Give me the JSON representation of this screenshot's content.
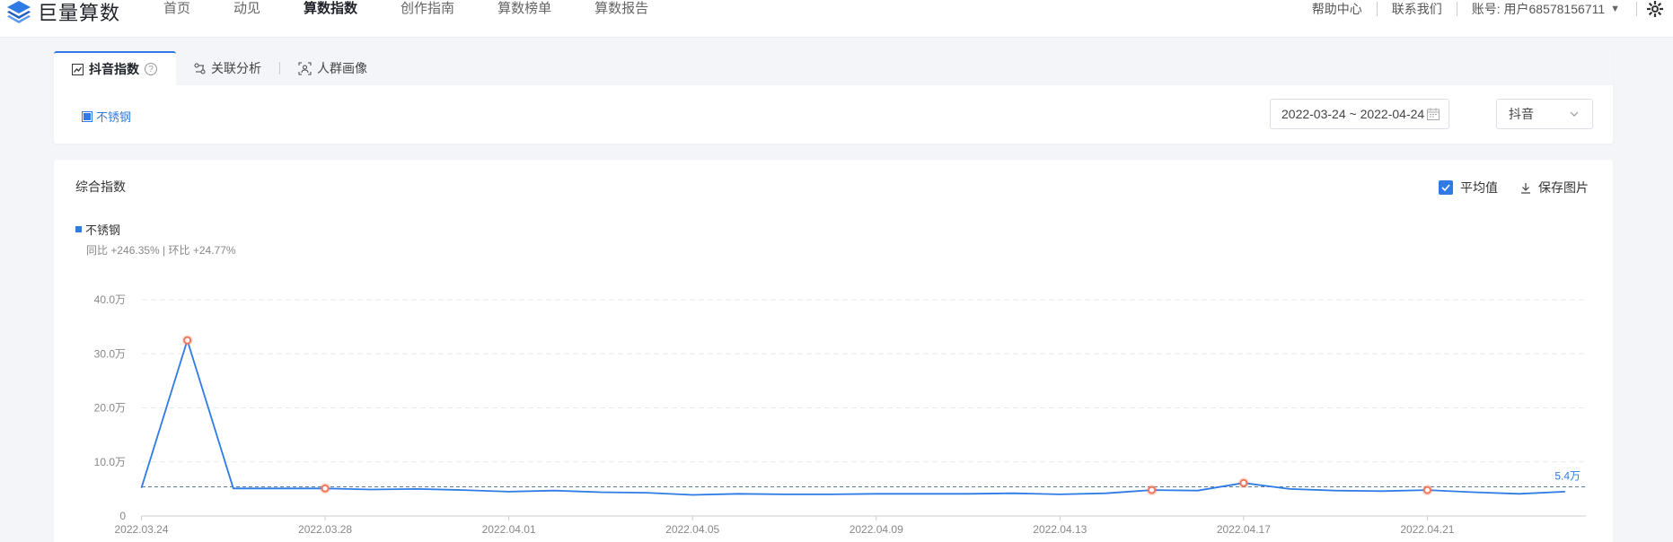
{
  "brand": {
    "name": "巨量算数",
    "logo_icon": "layers-logo-icon"
  },
  "nav": {
    "items": [
      {
        "label": "首页",
        "active": false
      },
      {
        "label": "动见",
        "active": false
      },
      {
        "label": "算数指数",
        "active": true
      },
      {
        "label": "创作指南",
        "active": false
      },
      {
        "label": "算数榜单",
        "active": false
      },
      {
        "label": "算数报告",
        "active": false
      }
    ]
  },
  "topright": {
    "help": "帮助中心",
    "contact": "联系我们",
    "account": "账号: 用户68578156711",
    "settings_icon": "settings-icon"
  },
  "tabs": [
    {
      "label": "抖音指数",
      "icon": "trend-icon",
      "active": true
    },
    {
      "label": "关联分析",
      "icon": "link-icon",
      "active": false
    },
    {
      "label": "人群画像",
      "icon": "person-scan-icon",
      "active": false
    }
  ],
  "keyword": "不锈钢",
  "filters": {
    "date_range": "2022-03-24 ~ 2022-04-24",
    "platform": "抖音"
  },
  "chart_panel": {
    "title": "综合指数",
    "avg_label": "平均值",
    "avg_checked": true,
    "save_label": "保存图片",
    "legend_name": "不锈钢",
    "stats": "同比 +246.35% | 环比 +24.77%"
  },
  "colors": {
    "accent": "#2f7be5",
    "highlight": "#f2775c",
    "grid": "#e6e9ee"
  },
  "chart_data": {
    "type": "line",
    "title": "综合指数",
    "unit": "万",
    "ylim": [
      0,
      40
    ],
    "y_ticks": [
      "0",
      "10.0万",
      "20.0万",
      "30.0万",
      "40.0万"
    ],
    "x_tick_labels": [
      "2022.03.24",
      "2022.03.28",
      "2022.04.01",
      "2022.04.05",
      "2022.04.09",
      "2022.04.13",
      "2022.04.17",
      "2022.04.21"
    ],
    "x": [
      "2022.03.24",
      "2022.03.25",
      "2022.03.26",
      "2022.03.27",
      "2022.03.28",
      "2022.03.29",
      "2022.03.30",
      "2022.03.31",
      "2022.04.01",
      "2022.04.02",
      "2022.04.03",
      "2022.04.04",
      "2022.04.05",
      "2022.04.06",
      "2022.04.07",
      "2022.04.08",
      "2022.04.09",
      "2022.04.10",
      "2022.04.11",
      "2022.04.12",
      "2022.04.13",
      "2022.04.14",
      "2022.04.15",
      "2022.04.16",
      "2022.04.17",
      "2022.04.18",
      "2022.04.19",
      "2022.04.20",
      "2022.04.21",
      "2022.04.22",
      "2022.04.23",
      "2022.04.24"
    ],
    "series": [
      {
        "name": "不锈钢",
        "values": [
          5.2,
          32.5,
          5.1,
          5.1,
          5.1,
          4.9,
          5.0,
          4.8,
          4.5,
          4.7,
          4.4,
          4.3,
          3.9,
          4.1,
          4.0,
          4.0,
          4.1,
          4.1,
          4.1,
          4.2,
          4.0,
          4.2,
          4.8,
          4.7,
          6.1,
          5.0,
          4.7,
          4.6,
          4.8,
          4.4,
          4.1,
          4.5
        ]
      }
    ],
    "average": 5.4,
    "average_label": "5.4万",
    "highlighted_points": [
      "2022.03.25",
      "2022.03.28",
      "2022.04.15",
      "2022.04.17",
      "2022.04.21"
    ],
    "grid": true
  }
}
